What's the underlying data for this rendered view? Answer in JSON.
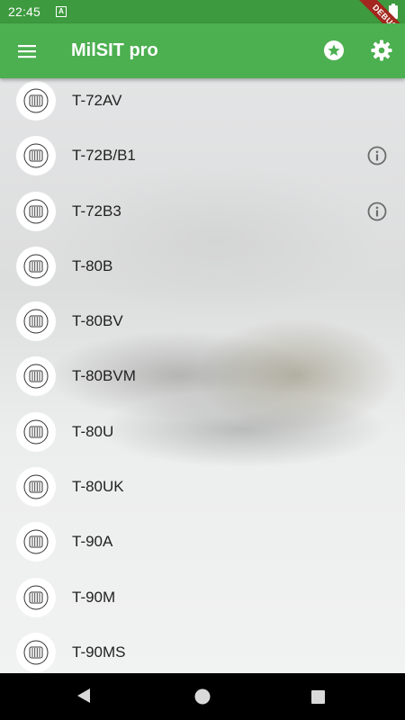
{
  "status_bar": {
    "time": "22:45",
    "notification_letter": "A",
    "debug_label": "DEBUG"
  },
  "app_bar": {
    "title": "MilSIT pro",
    "icons": [
      "menu-icon",
      "star-icon",
      "gear-icon"
    ]
  },
  "list": {
    "items": [
      {
        "label": "T-72AV",
        "info": false
      },
      {
        "label": "T-72B/B1",
        "info": true
      },
      {
        "label": "T-72B3",
        "info": true
      },
      {
        "label": "T-80B",
        "info": false
      },
      {
        "label": "T-80BV",
        "info": false
      },
      {
        "label": "T-80BVM",
        "info": false
      },
      {
        "label": "T-80U",
        "info": false
      },
      {
        "label": "T-80UK",
        "info": false
      },
      {
        "label": "T-90A",
        "info": false
      },
      {
        "label": "T-90M",
        "info": false
      },
      {
        "label": "T-90MS",
        "info": false
      }
    ]
  },
  "nav_bar": {
    "icons": [
      "back-icon",
      "home-icon",
      "recents-icon"
    ]
  },
  "colors": {
    "status_bar": "#3d9a3f",
    "app_bar": "#4caf50",
    "debug_ribbon": "#a3271e",
    "info_icon": "#6b6b6b"
  }
}
